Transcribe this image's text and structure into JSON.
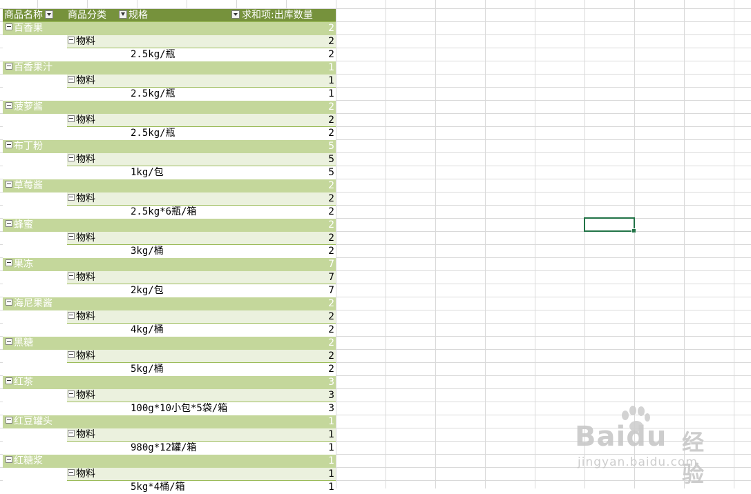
{
  "pivot": {
    "headers": {
      "col1": "商品名称",
      "col2": "商品分类",
      "col3": "规格",
      "col4": "求和项:出库数量"
    },
    "groups": [
      {
        "name": "百香果",
        "total": "2",
        "category": "物料",
        "cat_total": "2",
        "spec": "2.5kg/瓶",
        "spec_total": "2"
      },
      {
        "name": "百香果汁",
        "total": "1",
        "category": "物料",
        "cat_total": "1",
        "spec": "2.5kg/瓶",
        "spec_total": "1"
      },
      {
        "name": "菠萝酱",
        "total": "2",
        "category": "物料",
        "cat_total": "2",
        "spec": "2.5kg/瓶",
        "spec_total": "2"
      },
      {
        "name": "布丁粉",
        "total": "5",
        "category": "物料",
        "cat_total": "5",
        "spec": "1kg/包",
        "spec_total": "5"
      },
      {
        "name": "草莓酱",
        "total": "2",
        "category": "物料",
        "cat_total": "2",
        "spec": "2.5kg*6瓶/箱",
        "spec_total": "2"
      },
      {
        "name": "蜂蜜",
        "total": "2",
        "category": "物料",
        "cat_total": "2",
        "spec": "3kg/桶",
        "spec_total": "2"
      },
      {
        "name": "果冻",
        "total": "7",
        "category": "物料",
        "cat_total": "7",
        "spec": "2kg/包",
        "spec_total": "7"
      },
      {
        "name": "海尼果酱",
        "total": "2",
        "category": "物料",
        "cat_total": "2",
        "spec": "4kg/桶",
        "spec_total": "2"
      },
      {
        "name": "黑糖",
        "total": "2",
        "category": "物料",
        "cat_total": "2",
        "spec": "5kg/桶",
        "spec_total": "2"
      },
      {
        "name": "红茶",
        "total": "3",
        "category": "物料",
        "cat_total": "3",
        "spec": "100g*10小包*5袋/箱",
        "spec_total": "3"
      },
      {
        "name": "红豆罐头",
        "total": "1",
        "category": "物料",
        "cat_total": "1",
        "spec": "980g*12罐/箱",
        "spec_total": "1"
      },
      {
        "name": "红糖浆",
        "total": "1",
        "category": "物料",
        "cat_total": "1",
        "spec": "5kg*4桶/箱",
        "spec_total": "1"
      }
    ]
  },
  "watermark": {
    "brand": "Baidu",
    "product": "经验",
    "url": "jingyan.baidu.com"
  },
  "colors": {
    "header": "#76923c",
    "level1": "#c4d79b",
    "level2": "#ebf1de",
    "selection": "#217346"
  }
}
